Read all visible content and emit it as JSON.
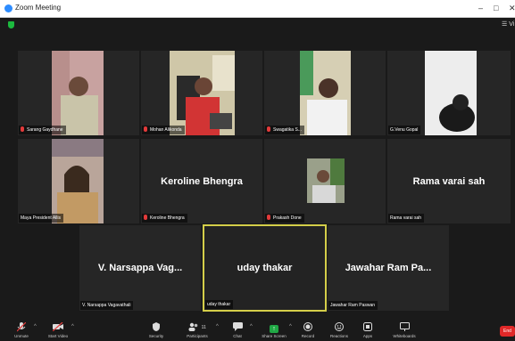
{
  "window": {
    "title": "Zoom Meeting",
    "minimize": "–",
    "maximize": "□",
    "close": "✕"
  },
  "topbar": {
    "view_label": "☰ Vi"
  },
  "participants": [
    {
      "display_name": "Sarang Gaydhane",
      "big_name": "",
      "muted": true
    },
    {
      "display_name": "Mohan Alikonda",
      "big_name": "",
      "muted": true
    },
    {
      "display_name": "Swagatika S...",
      "big_name": "",
      "muted": true
    },
    {
      "display_name": "G.Venu Gopal",
      "big_name": "",
      "muted": false
    },
    {
      "display_name": "Maya President Allis",
      "big_name": "",
      "muted": false
    },
    {
      "display_name": "Keroline Bhengra",
      "big_name": "Keroline Bhengra",
      "muted": true
    },
    {
      "display_name": "Prakash Done",
      "big_name": "",
      "muted": true
    },
    {
      "display_name": "Rama varai sah",
      "big_name": "Rama varai sah",
      "muted": false
    },
    {
      "display_name": "V. Narsappa Vagavathali",
      "big_name": "V. Narsappa Vag...",
      "muted": false
    },
    {
      "display_name": "uday thakar",
      "big_name": "uday thakar",
      "muted": false,
      "active_speaker": true
    },
    {
      "display_name": "Jawahar Ram Paswan",
      "big_name": "Jawahar Ram Pa...",
      "muted": false
    }
  ],
  "toolbar": {
    "unmute": "Unmute",
    "stop_video": "Start Video",
    "security": "Security",
    "participants": "Participants",
    "participants_count": "11",
    "chat": "Chat",
    "share_screen": "Share Screen",
    "record": "Record",
    "reactions": "Reactions",
    "apps": "Apps",
    "whiteboards": "Whiteboards",
    "end": "End"
  },
  "colors": {
    "active_speaker_border": "#d4ce49",
    "share_green": "#20a845",
    "end_red": "#e02828",
    "muted_red": "#e23a3a"
  }
}
